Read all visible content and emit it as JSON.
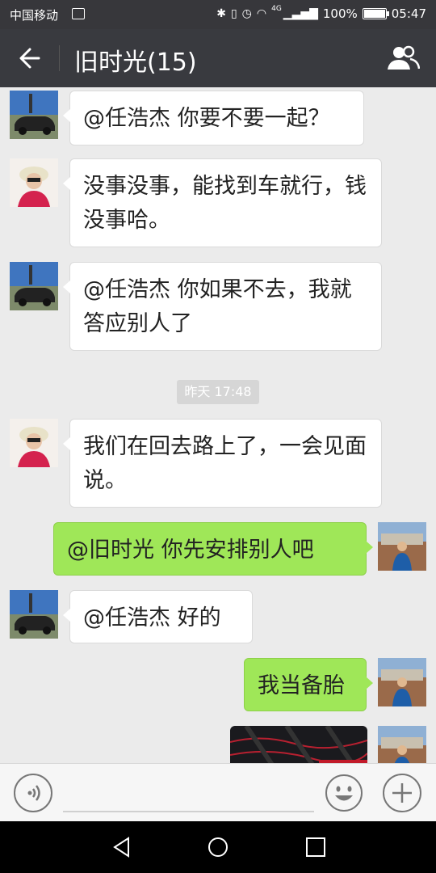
{
  "status_bar": {
    "carrier": "中国移动",
    "network": "4G",
    "battery": "100%",
    "battery_level": 1.0,
    "time": "05:47"
  },
  "header": {
    "title": "旧时光(15)"
  },
  "messages": [
    {
      "side": "left",
      "avatar": "car-avatar",
      "text": "@任浩杰  你要不要一起？"
    },
    {
      "side": "left",
      "avatar": "woman-avatar",
      "text": "没事没事，能找到车就行，钱没事哈。"
    },
    {
      "side": "left",
      "avatar": "car-avatar",
      "text": "@任浩杰  你如果不去，我就答应别人了"
    },
    {
      "side": "left",
      "avatar": "woman-avatar",
      "text": "我们在回去路上了，一会见面说。"
    },
    {
      "side": "right",
      "avatar": "self-avatar",
      "text": "@旧时光  你先安排别人吧"
    },
    {
      "side": "left",
      "avatar": "car-avatar",
      "text": "@任浩杰  好的"
    },
    {
      "side": "right",
      "avatar": "self-avatar",
      "text": "我当备胎"
    },
    {
      "side": "right",
      "avatar": "self-avatar",
      "text": ""
    }
  ],
  "timestamp": "昨天 17:48",
  "input_bar": {
    "voice_icon": "voice-icon",
    "emoji_icon": "emoji-icon",
    "plus_icon": "plus-icon"
  },
  "colors": {
    "header_bg": "#393a3f",
    "chat_bg": "#ebebeb",
    "sent_bubble": "#9fe758",
    "recv_bubble": "#ffffff"
  }
}
